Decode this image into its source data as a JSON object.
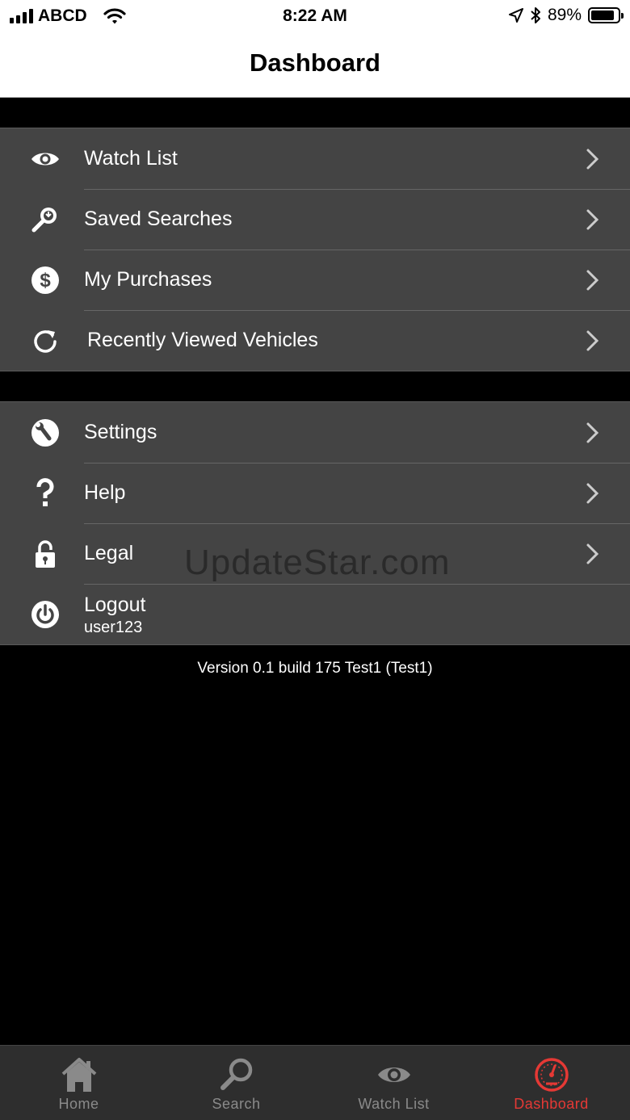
{
  "status_bar": {
    "carrier": "ABCD",
    "time": "8:22 AM",
    "battery_percent": "89%",
    "battery_level": 0.89,
    "icons": [
      "signal-bars-icon",
      "wifi-icon",
      "location-arrow-icon",
      "bluetooth-icon",
      "battery-icon"
    ]
  },
  "nav": {
    "title": "Dashboard"
  },
  "menu_group_1": {
    "items": [
      {
        "label": "Watch List",
        "icon": "eye-icon"
      },
      {
        "label": "Saved Searches",
        "icon": "saved-search-icon"
      },
      {
        "label": "My Purchases",
        "icon": "dollar-icon"
      },
      {
        "label": "Recently Viewed Vehicles",
        "icon": "refresh-icon"
      }
    ]
  },
  "menu_group_2": {
    "items": [
      {
        "label": "Settings",
        "icon": "wrench-icon"
      },
      {
        "label": "Help",
        "icon": "question-icon"
      },
      {
        "label": "Legal",
        "icon": "lock-icon"
      }
    ],
    "logout": {
      "label": "Logout",
      "username": "user123",
      "icon": "power-icon"
    }
  },
  "watermark": "UpdateStar.com",
  "version": "Version 0.1 build 175 Test1 (Test1)",
  "tabs": [
    {
      "label": "Home",
      "icon": "home-icon",
      "active": false
    },
    {
      "label": "Search",
      "icon": "search-icon",
      "active": false
    },
    {
      "label": "Watch List",
      "icon": "eye-icon",
      "active": false
    },
    {
      "label": "Dashboard",
      "icon": "speedometer-icon",
      "active": true
    }
  ],
  "colors": {
    "active_tab": "#e53935",
    "inactive_tab": "#8a8a8a",
    "row_background": "#444444",
    "tab_bar_background": "#2e2e2e"
  }
}
